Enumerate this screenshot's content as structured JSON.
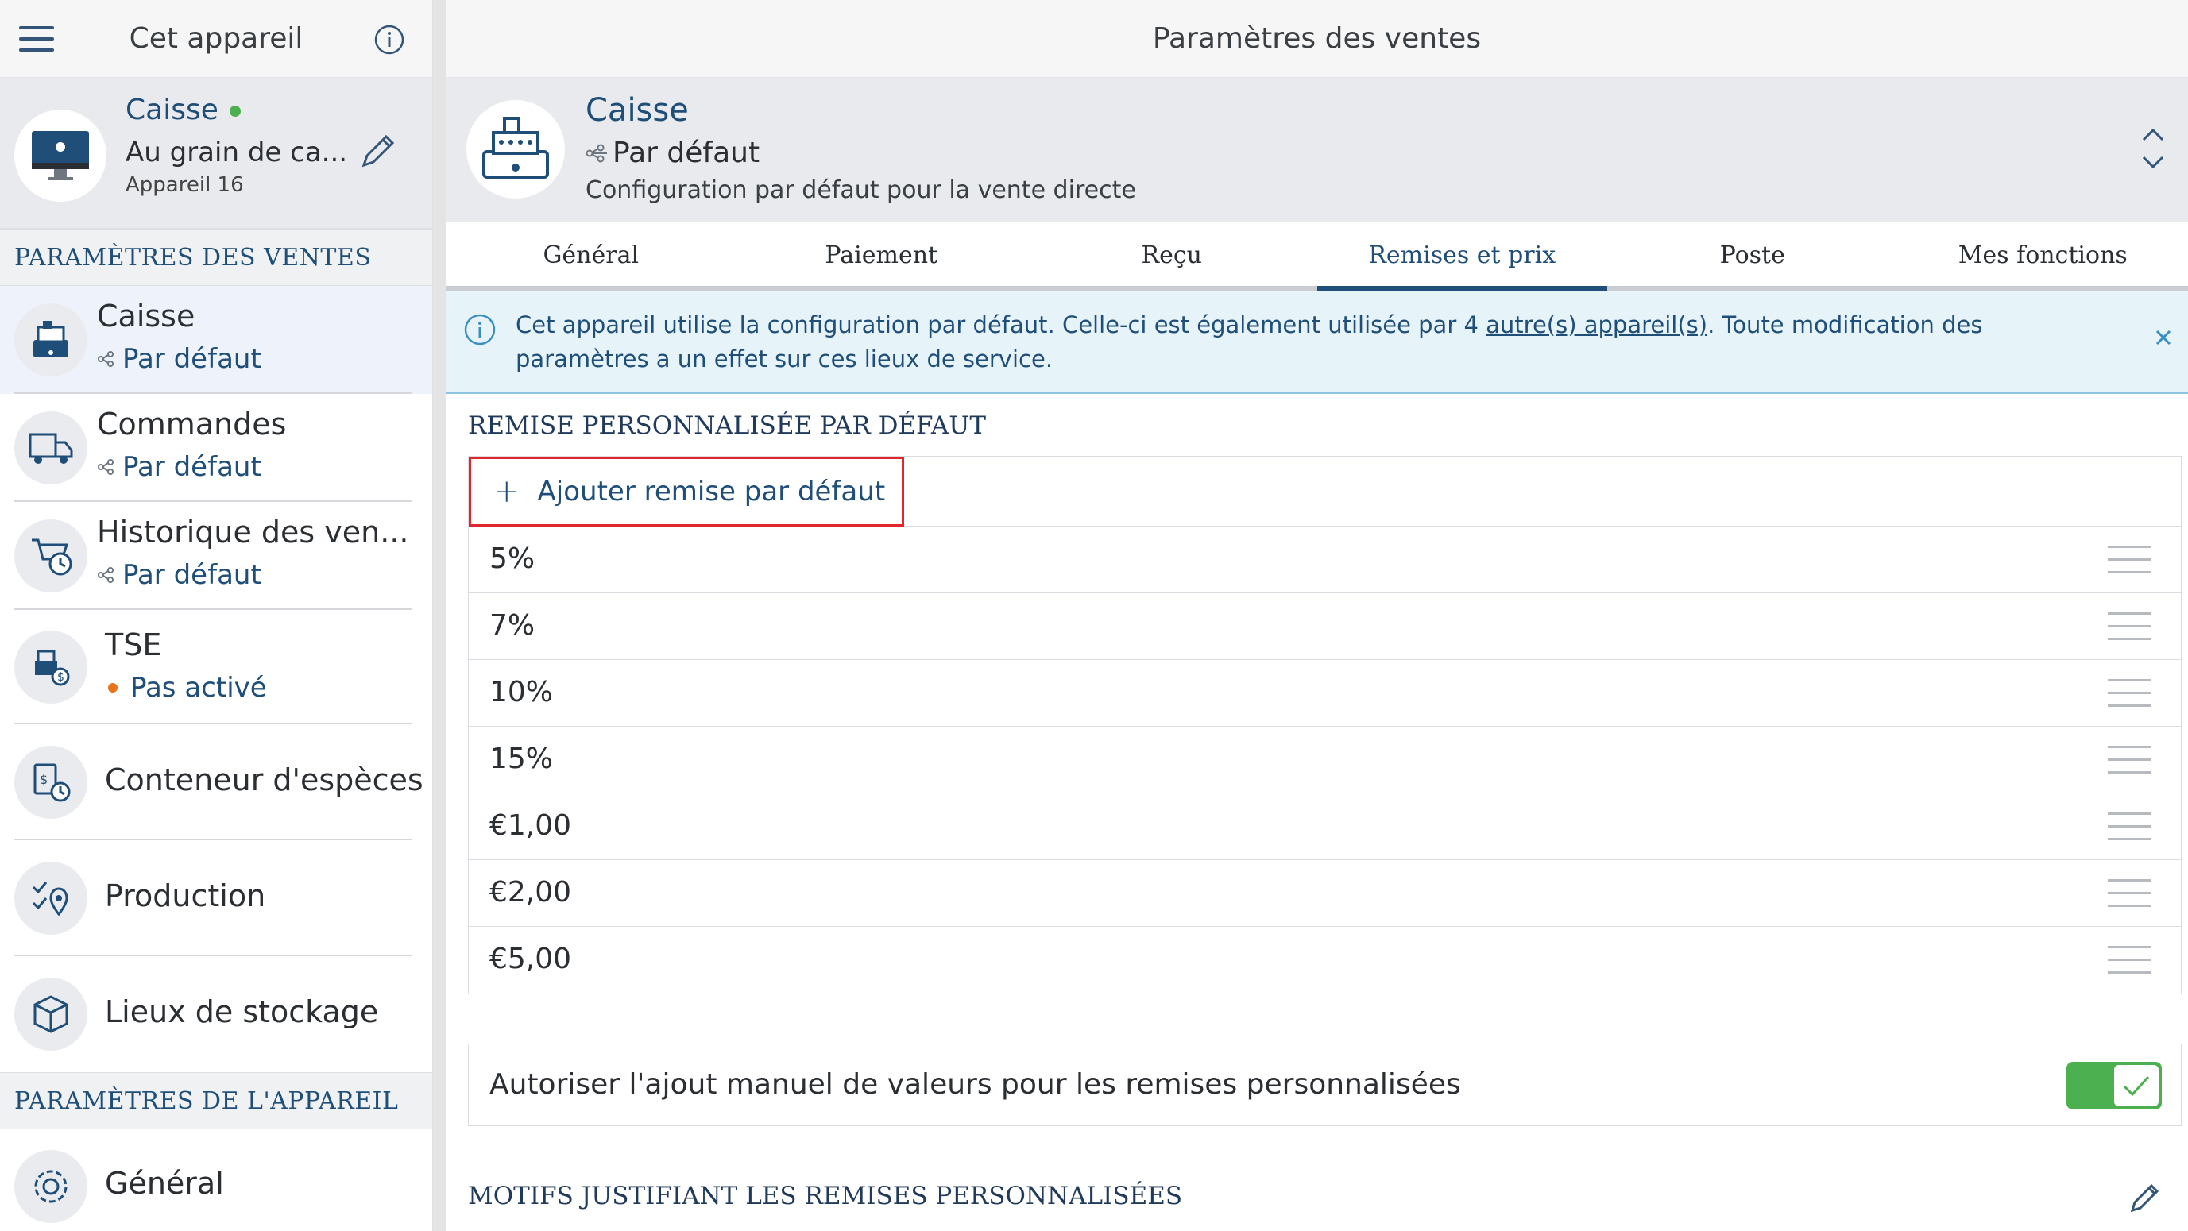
{
  "left": {
    "title": "Cet appareil",
    "device": {
      "name": "Caisse",
      "location": "Au grain de ca...",
      "number": "Appareil 16",
      "status_color": "#4caf50"
    },
    "sales_section_title": "PARAMÈTRES DES VENTES",
    "nav_items": [
      {
        "label": "Caisse",
        "sub": "Par défaut",
        "icon": "cash-register-icon"
      },
      {
        "label": "Commandes",
        "sub": "Par défaut",
        "icon": "delivery-truck-icon"
      },
      {
        "label": "Historique des ven...",
        "sub": "Par défaut",
        "icon": "sales-history-icon"
      },
      {
        "label": "TSE",
        "sub": "Pas activé",
        "icon": "tse-icon"
      },
      {
        "label": "Conteneur d'espèces",
        "icon": "cash-container-icon"
      },
      {
        "label": "Production",
        "icon": "production-icon"
      },
      {
        "label": "Lieux de stockage",
        "icon": "storage-icon"
      }
    ],
    "device_section_title": "PARAMÈTRES DE L'APPAREIL",
    "general_label": "Général"
  },
  "right": {
    "title": "Paramètres des ventes",
    "config": {
      "title": "Caisse",
      "profile": "Par défaut",
      "description": "Configuration par défaut pour la vente directe"
    },
    "tabs": [
      "Général",
      "Paiement",
      "Reçu",
      "Remises et prix",
      "Poste",
      "Mes fonctions"
    ],
    "active_tab": "Remises et prix",
    "banner": {
      "text_before": "Cet appareil utilise la configuration par défaut. Celle-ci est également utilisée par 4 ",
      "link": "autre(s) appareil(s)",
      "text_after": ". Toute modification des paramètres a un effet sur ces lieux de service."
    },
    "discount_section_title": "REMISE PERSONNALISÉE PAR DÉFAUT",
    "add_label": "Ajouter remise par défaut",
    "discounts": [
      "5%",
      "7%",
      "10%",
      "15%",
      "€1,00",
      "€2,00",
      "€5,00"
    ],
    "toggle_label": "Autoriser l'ajout manuel de valeurs pour les remises personnalisées",
    "toggle_on": true,
    "reasons_section_title": "MOTIFS JUSTIFIANT LES REMISES PERSONNALISÉES"
  },
  "colors": {
    "accent": "#1f4e79",
    "highlight": "#e3262b",
    "toggle_on": "#4caf50",
    "warning_dot": "#e8731a"
  }
}
